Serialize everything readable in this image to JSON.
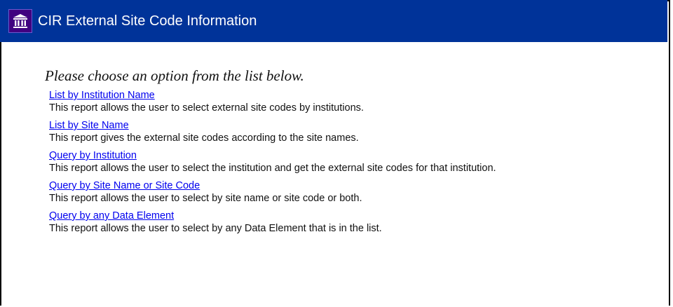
{
  "header": {
    "title": "CIR External Site Code Information",
    "logo_icon": "institution-building-icon",
    "background_color": "#003399"
  },
  "main": {
    "prompt": "Please choose an option from the list below.",
    "options": [
      {
        "label": "List by Institution Name",
        "description": "This report allows the user to select external site codes by institutions."
      },
      {
        "label": "List by Site Name",
        "description": "This report gives the external site codes according to the site names."
      },
      {
        "label": "Query by Institution",
        "description": "This report allows the user to select the institution and get the external site codes for that institution."
      },
      {
        "label": "Query by Site Name or Site Code",
        "description": "This report allows the user to select by site name or site code or both."
      },
      {
        "label": "Query by any Data Element",
        "description": "This report allows the user to select by any Data Element that is in the list."
      }
    ]
  }
}
